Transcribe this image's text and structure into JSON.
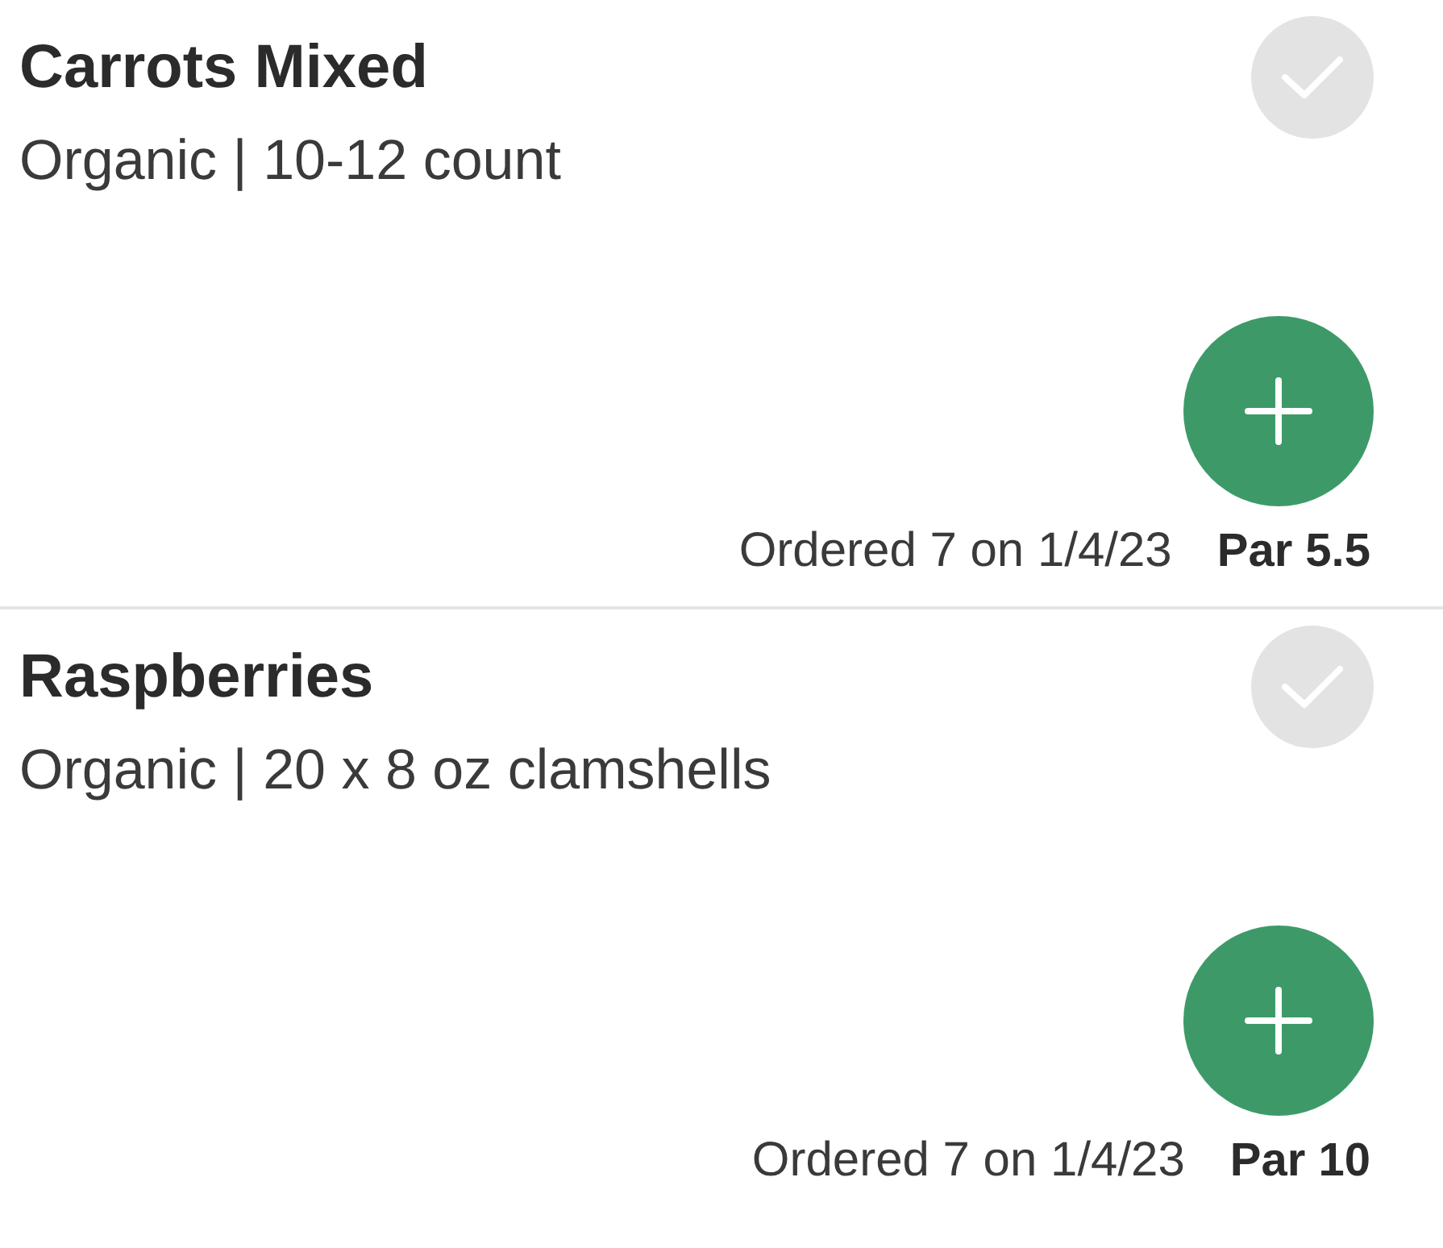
{
  "items": [
    {
      "name": "Carrots Mixed",
      "description": "Organic | 10-12 count",
      "checked": false,
      "ordered": "Ordered 7 on 1/4/23",
      "par": "Par 5.5"
    },
    {
      "name": "Raspberries",
      "description": "Organic | 20 x 8 oz clamshells",
      "checked": false,
      "ordered": "Ordered 7 on 1/4/23",
      "par": "Par 10"
    }
  ]
}
